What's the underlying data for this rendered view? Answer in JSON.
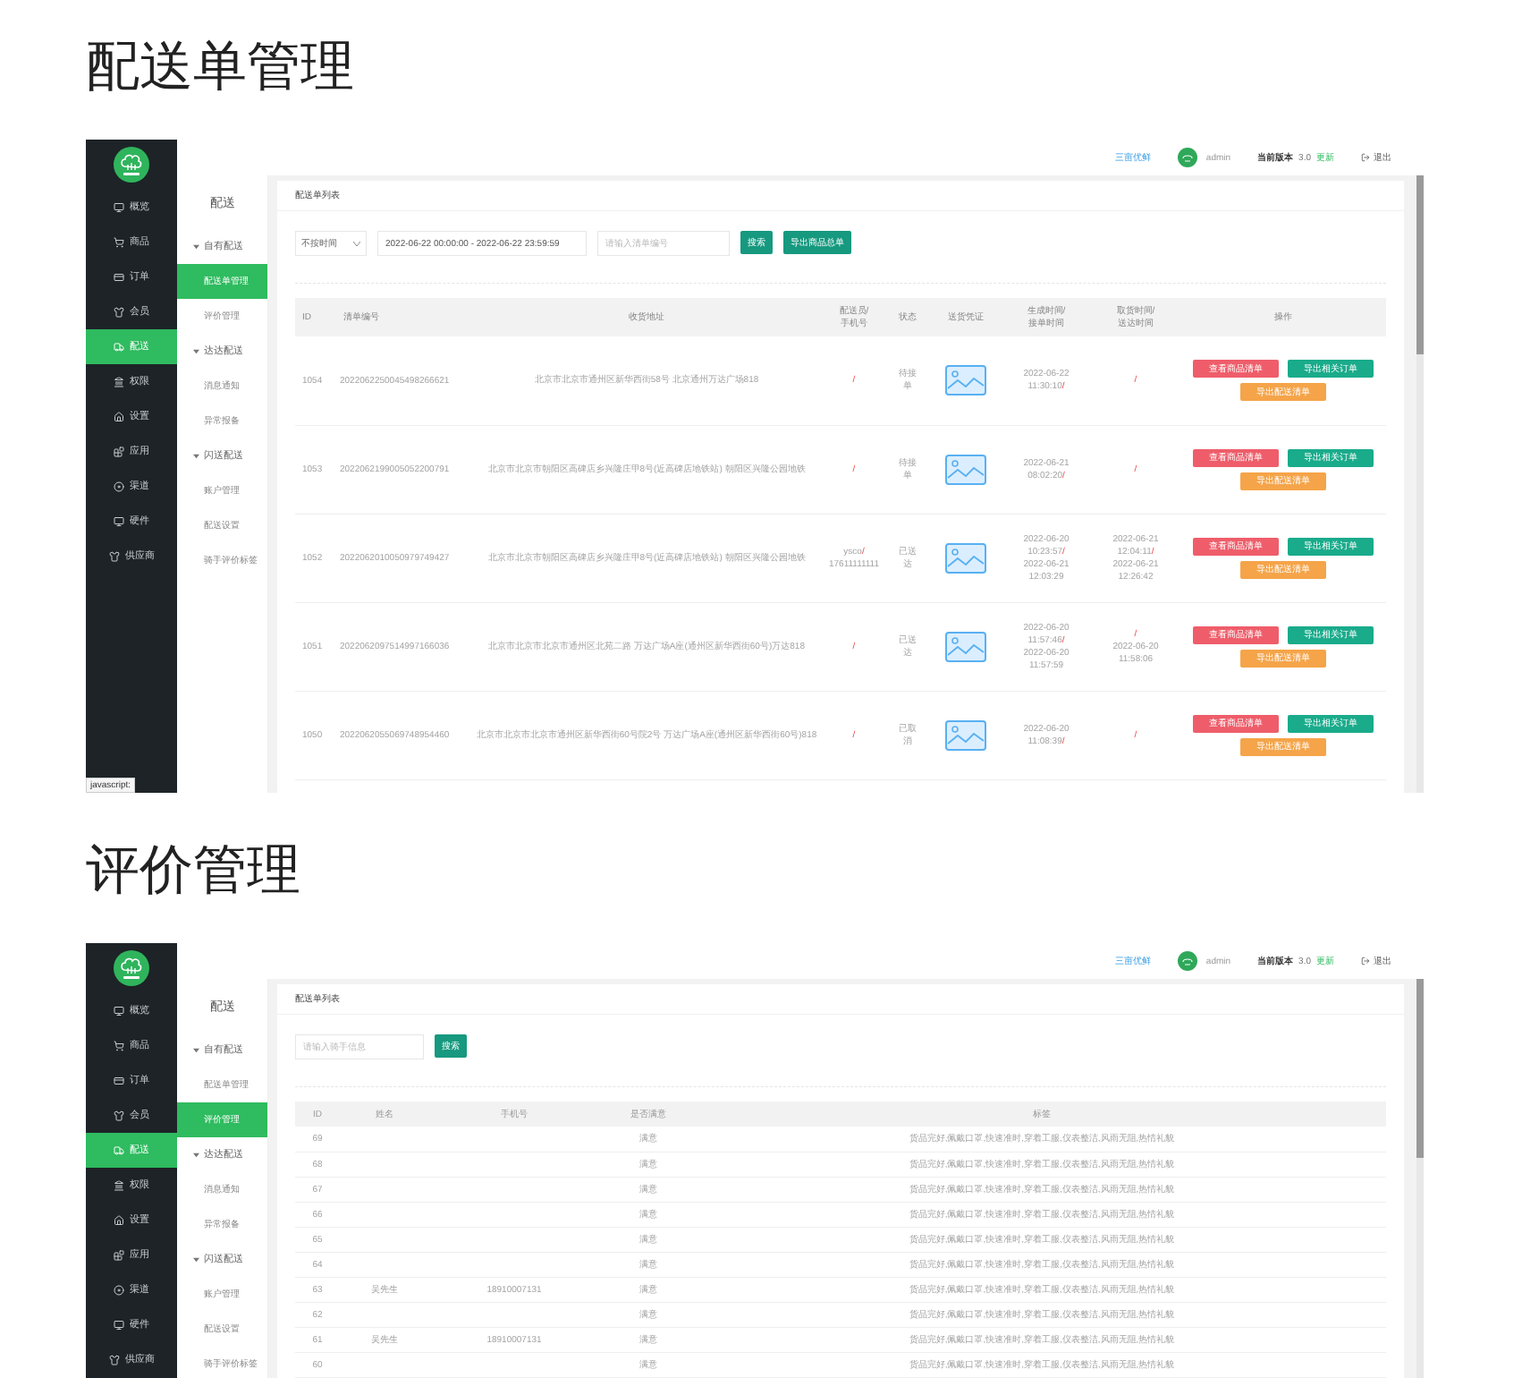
{
  "sections": [
    {
      "heading": "配送单管理",
      "screenshot": {
        "nav": [
          {
            "label": "概览",
            "selected": false
          },
          {
            "label": "商品",
            "selected": false
          },
          {
            "label": "订单",
            "selected": false
          },
          {
            "label": "会员",
            "selected": false
          },
          {
            "label": "配送",
            "selected": true
          },
          {
            "label": "权限",
            "selected": false
          },
          {
            "label": "设置",
            "selected": false
          },
          {
            "label": "应用",
            "selected": false
          },
          {
            "label": "渠道",
            "selected": false
          },
          {
            "label": "硬件",
            "selected": false
          },
          {
            "label": "供应商",
            "selected": false
          }
        ],
        "subnav": {
          "title": "配送",
          "groups": [
            {
              "label": "自有配送",
              "expanded": true,
              "items": [
                {
                  "label": "配送单管理",
                  "selected": true
                },
                {
                  "label": "评价管理",
                  "selected": false
                }
              ]
            },
            {
              "label": "达达配送",
              "expanded": true,
              "items": [
                {
                  "label": "消息通知",
                  "selected": false
                },
                {
                  "label": "异常报备",
                  "selected": false
                }
              ]
            },
            {
              "label": "闪送配送",
              "expanded": true,
              "items": [
                {
                  "label": "账户管理",
                  "selected": false
                },
                {
                  "label": "配送设置",
                  "selected": false
                },
                {
                  "label": "骑手评价标签",
                  "selected": false
                }
              ]
            }
          ]
        },
        "topbar": {
          "shop": "三亩优鲜",
          "user": "admin",
          "version_label": "当前版本",
          "version": "3.0",
          "update": "更新",
          "logout": "退出"
        },
        "card_title": "配送单列表",
        "content": {
          "kind": "orders",
          "time_select": "不按时间",
          "date_range": "2022-06-22 00:00:00 - 2022-06-22 23:59:59",
          "search_placeholder": "请输入清单编号",
          "buttons": [
            "搜索",
            "导出商品总单"
          ],
          "columns": [
            [
              "ID"
            ],
            [
              "清单编号"
            ],
            [
              "收货地址"
            ],
            [
              "配送员/",
              "手机号"
            ],
            [
              "状态"
            ],
            [
              "送货凭证"
            ],
            [
              "生成时间/",
              "接单时间"
            ],
            [
              "取货时间/",
              "送达时间"
            ],
            [
              "操作"
            ]
          ],
          "rows": [
            {
              "id": "1054",
              "code": "2022062250045498266621",
              "address": "北京市北京市通州区新华西街58号 北京通州万达广场818",
              "courier": [
                {
                  "text": "/",
                  "accent": true
                }
              ],
              "status": "待接单",
              "created": [
                {
                  "text": "2022-06-22 11:30:10",
                  "accent": false
                },
                {
                  "text": "/",
                  "accent": true
                }
              ],
              "picked": [
                {
                  "text": "/",
                  "accent": true
                }
              ],
              "actions": [
                {
                  "label": "查看商品清单",
                  "color": "#ef5d6a"
                },
                {
                  "label": "导出相关订单",
                  "color": "#1aab8b"
                },
                {
                  "label": "导出配送清单",
                  "color": "#f5a449"
                }
              ]
            },
            {
              "id": "1053",
              "code": "2022062199005052200791",
              "address": "北京市北京市朝阳区高碑店乡兴隆庄甲8号(近高碑店地铁站) 朝阳区兴隆公园地铁",
              "courier": [
                {
                  "text": "/",
                  "accent": true
                }
              ],
              "status": "待接单",
              "created": [
                {
                  "text": "2022-06-21 08:02:20",
                  "accent": false
                },
                {
                  "text": "/",
                  "accent": true
                }
              ],
              "picked": [
                {
                  "text": "/",
                  "accent": true
                }
              ],
              "actions": [
                {
                  "label": "查看商品清单",
                  "color": "#ef5d6a"
                },
                {
                  "label": "导出相关订单",
                  "color": "#1aab8b"
                },
                {
                  "label": "导出配送清单",
                  "color": "#f5a449"
                }
              ]
            },
            {
              "id": "1052",
              "code": "2022062010050979749427",
              "address": "北京市北京市朝阳区高碑店乡兴隆庄甲8号(近高碑店地铁站) 朝阳区兴隆公园地铁",
              "courier": [
                {
                  "text": "ysco",
                  "accent": false
                },
                {
                  "text": "/",
                  "accent": true
                },
                {
                  "text": "17611111111",
                  "accent": false
                }
              ],
              "status": "已送达",
              "created": [
                {
                  "text": "2022-06-20 10:23:57",
                  "accent": false
                },
                {
                  "text": "/",
                  "accent": true
                },
                {
                  "text": "2022-06-21 12:03:29",
                  "accent": false
                }
              ],
              "picked": [
                {
                  "text": "2022-06-21 12:04:11",
                  "accent": false
                },
                {
                  "text": "/",
                  "accent": true
                },
                {
                  "text": "2022-06-21 12:26:42",
                  "accent": false
                }
              ],
              "actions": [
                {
                  "label": "查看商品清单",
                  "color": "#ef5d6a"
                },
                {
                  "label": "导出相关订单",
                  "color": "#1aab8b"
                },
                {
                  "label": "导出配送清单",
                  "color": "#f5a449"
                }
              ]
            },
            {
              "id": "1051",
              "code": "2022062097514997166036",
              "address": "北京市北京市北京市通州区北苑二路 万达广场A座(通州区新华西街60号)万达818",
              "courier": [
                {
                  "text": "/",
                  "accent": true
                }
              ],
              "status": "已送达",
              "created": [
                {
                  "text": "2022-06-20 11:57:46",
                  "accent": false
                },
                {
                  "text": "/",
                  "accent": true
                },
                {
                  "text": "2022-06-20 11:57:59",
                  "accent": false
                }
              ],
              "picked": [
                {
                  "text": "/",
                  "accent": true
                },
                {
                  "text": "2022-06-20 11:58:06",
                  "accent": false
                }
              ],
              "actions": [
                {
                  "label": "查看商品清单",
                  "color": "#ef5d6a"
                },
                {
                  "label": "导出相关订单",
                  "color": "#1aab8b"
                },
                {
                  "label": "导出配送清单",
                  "color": "#f5a449"
                }
              ]
            },
            {
              "id": "1050",
              "code": "2022062055069748954460",
              "address": "北京市北京市北京市通州区新华西街60号院2号 万达广场A座(通州区新华西街60号)818",
              "courier": [
                {
                  "text": "/",
                  "accent": true
                }
              ],
              "status": "已取消",
              "created": [
                {
                  "text": "2022-06-20 11:08:39",
                  "accent": false
                },
                {
                  "text": "/",
                  "accent": true
                }
              ],
              "picked": [
                {
                  "text": "/",
                  "accent": true
                }
              ],
              "actions": [
                {
                  "label": "查看商品清单",
                  "color": "#ef5d6a"
                },
                {
                  "label": "导出相关订单",
                  "color": "#1aab8b"
                },
                {
                  "label": "导出配送清单",
                  "color": "#f5a449"
                }
              ]
            }
          ]
        },
        "status_text": "javascript:"
      }
    },
    {
      "heading": "评价管理",
      "screenshot": {
        "nav": [
          {
            "label": "概览",
            "selected": false
          },
          {
            "label": "商品",
            "selected": false
          },
          {
            "label": "订单",
            "selected": false
          },
          {
            "label": "会员",
            "selected": false
          },
          {
            "label": "配送",
            "selected": true
          },
          {
            "label": "权限",
            "selected": false
          },
          {
            "label": "设置",
            "selected": false
          },
          {
            "label": "应用",
            "selected": false
          },
          {
            "label": "渠道",
            "selected": false
          },
          {
            "label": "硬件",
            "selected": false
          },
          {
            "label": "供应商",
            "selected": false
          }
        ],
        "subnav": {
          "title": "配送",
          "groups": [
            {
              "label": "自有配送",
              "expanded": true,
              "items": [
                {
                  "label": "配送单管理",
                  "selected": false
                },
                {
                  "label": "评价管理",
                  "selected": true
                }
              ]
            },
            {
              "label": "达达配送",
              "expanded": true,
              "items": [
                {
                  "label": "消息通知",
                  "selected": false
                },
                {
                  "label": "异常报备",
                  "selected": false
                }
              ]
            },
            {
              "label": "闪送配送",
              "expanded": true,
              "items": [
                {
                  "label": "账户管理",
                  "selected": false
                },
                {
                  "label": "配送设置",
                  "selected": false
                },
                {
                  "label": "骑手评价标签",
                  "selected": false
                }
              ]
            }
          ]
        },
        "topbar": {
          "shop": "三亩优鲜",
          "user": "admin",
          "version_label": "当前版本",
          "version": "3.0",
          "update": "更新",
          "logout": "退出"
        },
        "card_title": "配送单列表",
        "content": {
          "kind": "reviews",
          "search_placeholder": "请输入骑手信息",
          "buttons": [
            "搜索"
          ],
          "columns": [
            "ID",
            "姓名",
            "手机号",
            "是否满意",
            "标签"
          ],
          "rows": [
            {
              "id": "69",
              "satisfied": "满意",
              "tags": "货品完好,佩戴口罩,快速准时,穿着工服,仪表整洁,风雨无阻,热情礼貌"
            },
            {
              "id": "68",
              "satisfied": "满意",
              "tags": "货品完好,佩戴口罩,快速准时,穿着工服,仪表整洁,风雨无阻,热情礼貌"
            },
            {
              "id": "67",
              "satisfied": "满意",
              "tags": "货品完好,佩戴口罩,快速准时,穿着工服,仪表整洁,风雨无阻,热情礼貌"
            },
            {
              "id": "66",
              "satisfied": "满意",
              "tags": "货品完好,佩戴口罩,快速准时,穿着工服,仪表整洁,风雨无阻,热情礼貌"
            },
            {
              "id": "65",
              "satisfied": "满意",
              "tags": "货品完好,佩戴口罩,快速准时,穿着工服,仪表整洁,风雨无阻,热情礼貌"
            },
            {
              "id": "64",
              "satisfied": "满意",
              "tags": "货品完好,佩戴口罩,快速准时,穿着工服,仪表整洁,风雨无阻,热情礼貌"
            },
            {
              "id": "63",
              "name": "吴先生",
              "phone": "18910007131",
              "satisfied": "满意",
              "tags": "货品完好,佩戴口罩,快速准时,穿着工服,仪表整洁,风雨无阻,热情礼貌"
            },
            {
              "id": "62",
              "satisfied": "满意",
              "tags": "货品完好,佩戴口罩,快速准时,穿着工服,仪表整洁,风雨无阻,热情礼貌"
            },
            {
              "id": "61",
              "name": "吴先生",
              "phone": "18910007131",
              "satisfied": "满意",
              "tags": "货品完好,佩戴口罩,快速准时,穿着工服,仪表整洁,风雨无阻,热情礼貌"
            },
            {
              "id": "60",
              "satisfied": "满意",
              "tags": "货品完好,佩戴口罩,快速准时,穿着工服,仪表整洁,风雨无阻,热情礼貌"
            }
          ]
        }
      }
    }
  ]
}
